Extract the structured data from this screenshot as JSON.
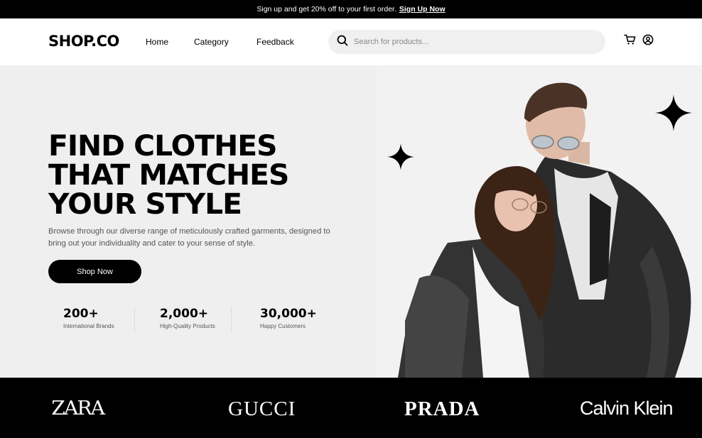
{
  "announcement": {
    "text": "Sign up and get 20% off to your first order.",
    "link": "Sign Up Now"
  },
  "nav": {
    "logo": "SHOP.CO",
    "links": [
      "Home",
      "Category",
      "Feedback"
    ],
    "search_placeholder": "Search for products...",
    "icons": [
      "search-icon",
      "cart-icon",
      "account-icon"
    ]
  },
  "hero": {
    "headline": [
      "FIND CLOTHES",
      "THAT MATCHES",
      "YOUR STYLE"
    ],
    "description": "Browse through our diverse range of meticulously crafted garments, designed to bring out your individuality and cater to your sense of style.",
    "cta": "Shop Now",
    "stats": [
      {
        "value": "200+",
        "label": "International Brands"
      },
      {
        "value": "2,000+",
        "label": "High-Quality Products"
      },
      {
        "value": "30,000+",
        "label": "Happy Customers"
      }
    ]
  },
  "brands": [
    "ZARA",
    "GUCCI",
    "PRADA",
    "Calvin Klein"
  ],
  "colors": {
    "primary": "#000000",
    "hero_bg": "#f0eff0",
    "search_bg": "#f0f0f0"
  }
}
